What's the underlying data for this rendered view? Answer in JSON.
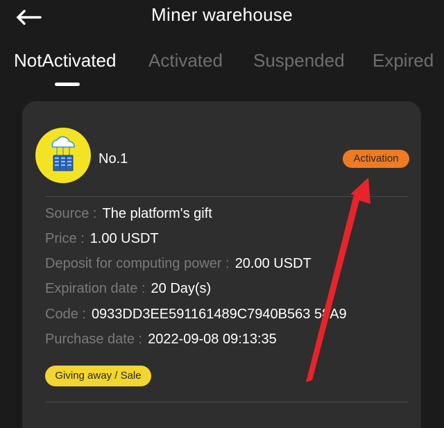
{
  "header": {
    "title": "Miner warehouse",
    "back_icon": "arrow-left-icon"
  },
  "tabs": [
    {
      "label": "NotActivated",
      "active": true
    },
    {
      "label": "Activated",
      "active": false
    },
    {
      "label": "Suspended",
      "active": false
    },
    {
      "label": "Expired",
      "active": false
    }
  ],
  "card": {
    "avatar_icon": "cloud-server-icon",
    "name": "No.1",
    "activation_label": "Activation",
    "rows": [
      {
        "label": "Source :",
        "value": "The platform's gift"
      },
      {
        "label": "Price :",
        "value": "1.00 USDT"
      },
      {
        "label": "Deposit for computing power :",
        "value": "20.00 USDT"
      },
      {
        "label": "Expiration date :",
        "value": "20 Day(s)"
      },
      {
        "label": "Code :",
        "value": "0933DD3EE591161489C7940B563 58A9"
      },
      {
        "label": "Purchase date :",
        "value": "2022-09-08 09:13:35"
      }
    ],
    "giving_label": "Giving away / Sale"
  },
  "colors": {
    "background": "#1b1b1b",
    "card": "#2e2e2e",
    "activation": "#ee7b22",
    "giving": "#f2d531",
    "avatar": "#f4e324",
    "annotation_arrow": "#e8242b"
  }
}
